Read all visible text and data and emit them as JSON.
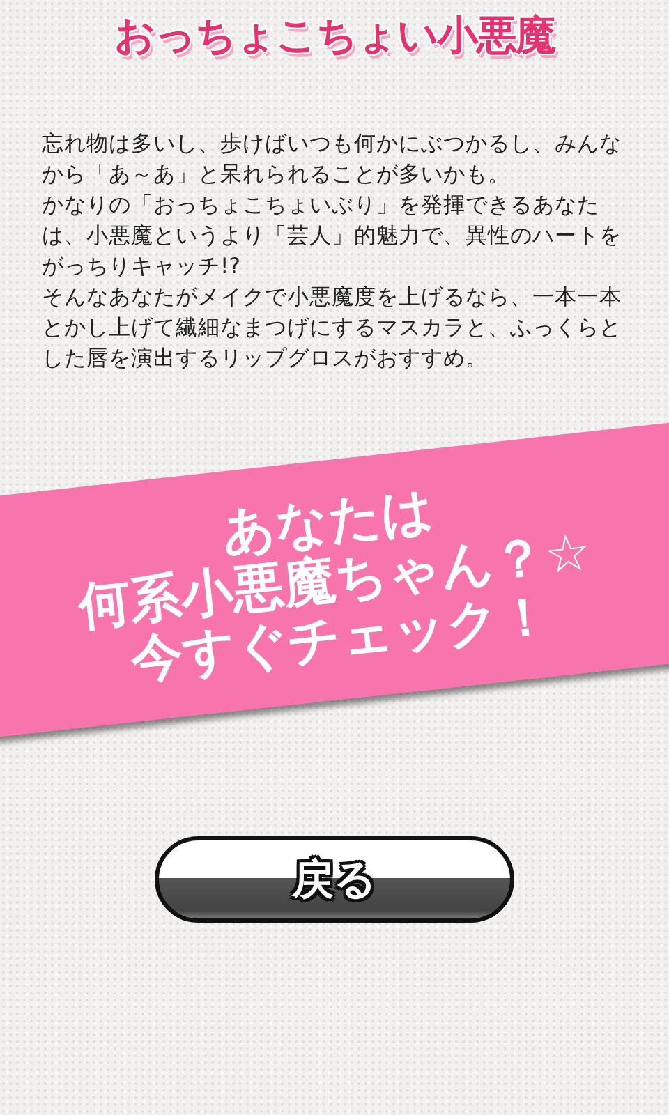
{
  "title": "おっちょこちょい小悪魔",
  "paragraphs": [
    "忘れ物は多いし、歩けばいつも何かにぶつかるし、みんなから「あ～あ」と呆れられることが多いかも。",
    "かなりの「おっちょこちょいぶり」を発揮できるあなたは、小悪魔というより「芸人」的魅力で、異性のハートをがっちりキャッチ!?",
    "そんなあなたがメイクで小悪魔度を上げるなら、一本一本とかし上げて繊細なまつげにするマスカラと、ふっくらとした唇を演出するリップグロスがおすすめ。"
  ],
  "banner": {
    "lines": [
      "あなたは",
      "何系小悪魔ちゃん？☆",
      "今すぐチェック！"
    ]
  },
  "back_button": {
    "label": "戻る"
  }
}
